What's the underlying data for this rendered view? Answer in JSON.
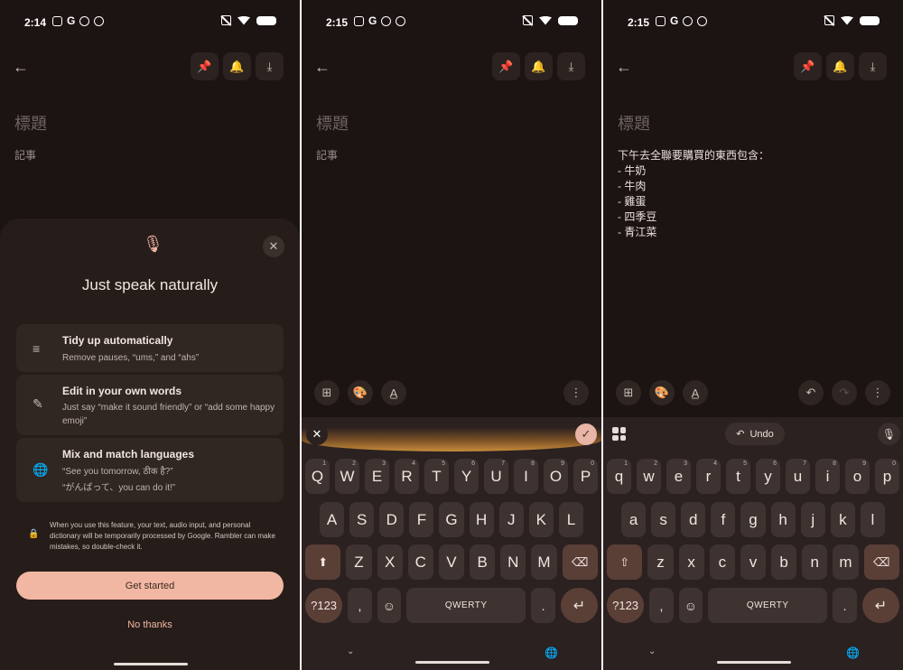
{
  "screens": [
    {
      "status": {
        "time": "2:14",
        "g": "G"
      },
      "note": {
        "title_placeholder": "標題",
        "body_placeholder": "記事"
      },
      "sheet": {
        "title": "Just speak naturally",
        "features": [
          {
            "title": "Tidy up automatically",
            "desc": "Remove pauses, “ums,” and “ahs”"
          },
          {
            "title": "Edit in your own words",
            "desc": "Just say “make it sound friendly” or “add some happy emoji”"
          },
          {
            "title": "Mix and match languages",
            "desc": "“See you tomorrow, ठीक है?”",
            "desc2": "“がんばって、you can do it!”"
          }
        ],
        "disclaimer": "When you use this feature, your text, audio input, and personal dictionary will be temporarily processed by Google. Rambler can make mistakes, so double-check it.",
        "primary_button": "Get started",
        "secondary_button": "No thanks"
      }
    },
    {
      "status": {
        "time": "2:15",
        "g": "G"
      },
      "note": {
        "title_placeholder": "標題",
        "body_placeholder": "記事"
      },
      "keyboard": {
        "row1": [
          "Q",
          "W",
          "E",
          "R",
          "T",
          "Y",
          "U",
          "I",
          "O",
          "P"
        ],
        "row1_hints": [
          "1",
          "2",
          "3",
          "4",
          "5",
          "6",
          "7",
          "8",
          "9",
          "0"
        ],
        "row2": [
          "A",
          "S",
          "D",
          "F",
          "G",
          "H",
          "J",
          "K",
          "L"
        ],
        "row3": [
          "Z",
          "X",
          "C",
          "V",
          "B",
          "N",
          "M"
        ],
        "symbols": "?123",
        "comma": ",",
        "space": "QWERTY",
        "period": "."
      }
    },
    {
      "status": {
        "time": "2:15",
        "g": "G"
      },
      "note": {
        "title_placeholder": "標題",
        "lines": [
          "下午去全聯要購買的東西包含：",
          "- 牛奶",
          "- 牛肉",
          "- 雞蛋",
          "- 四季豆",
          "- 青江菜"
        ]
      },
      "keyboard": {
        "undo": "Undo",
        "row1": [
          "q",
          "w",
          "e",
          "r",
          "t",
          "y",
          "u",
          "i",
          "o",
          "p"
        ],
        "row1_hints": [
          "1",
          "2",
          "3",
          "4",
          "5",
          "6",
          "7",
          "8",
          "9",
          "0"
        ],
        "row2": [
          "a",
          "s",
          "d",
          "f",
          "g",
          "h",
          "j",
          "k",
          "l"
        ],
        "row3": [
          "z",
          "x",
          "c",
          "v",
          "b",
          "n",
          "m"
        ],
        "symbols": "?123",
        "comma": ",",
        "space": "QWERTY",
        "period": "."
      }
    }
  ]
}
